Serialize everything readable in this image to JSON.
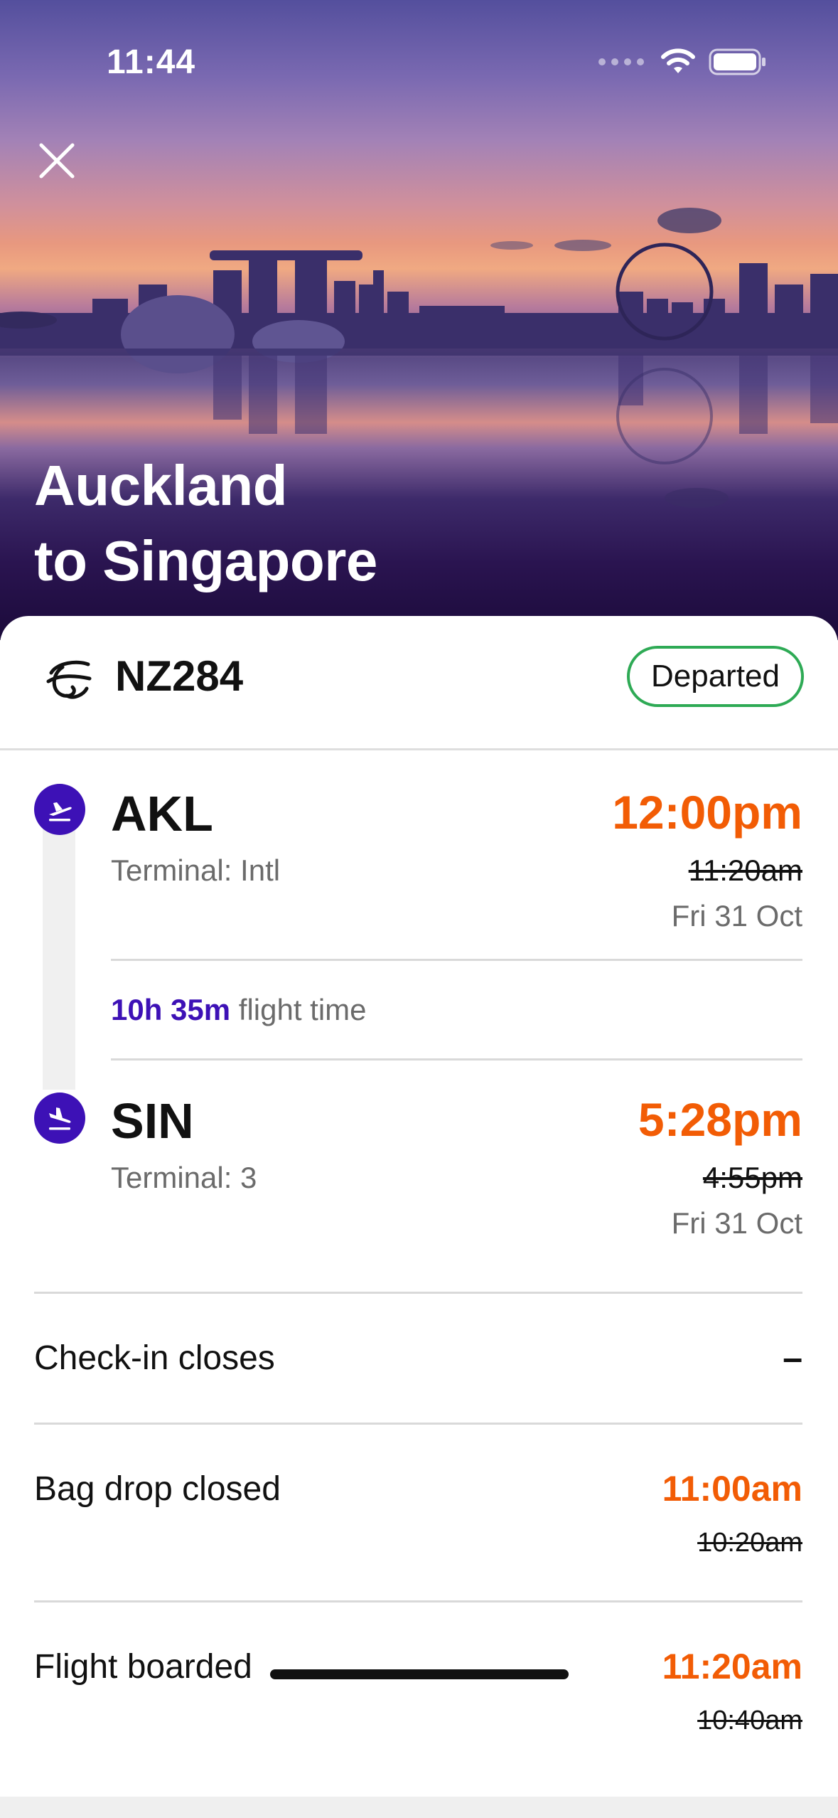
{
  "status_bar": {
    "time": "11:44"
  },
  "hero": {
    "title_line1": "Auckland",
    "title_line2": "to Singapore"
  },
  "flight": {
    "number": "NZ284",
    "status": "Departed"
  },
  "departure": {
    "code": "AKL",
    "terminal": "Terminal: Intl",
    "time_new": "12:00pm",
    "time_old": "11:20am",
    "date": "Fri 31 Oct"
  },
  "duration": {
    "value": "10h 35m",
    "label": "flight time"
  },
  "arrival": {
    "code": "SIN",
    "terminal": "Terminal: 3",
    "time_new": "5:28pm",
    "time_old": "4:55pm",
    "date": "Fri 31 Oct"
  },
  "milestones": [
    {
      "label": "Check-in closes",
      "value": "–"
    },
    {
      "label": "Bag drop closed",
      "time_new": "11:00am",
      "time_old": "10:20am"
    },
    {
      "label": "Flight boarded",
      "time_new": "11:20am",
      "time_old": "10:40am"
    }
  ],
  "colors": {
    "accent": "#3d11b6",
    "delay": "#f25c05",
    "badge_border": "#2eaa55"
  },
  "icons": [
    "close-icon",
    "airline-koru-icon",
    "takeoff-icon",
    "landing-icon",
    "wifi-icon",
    "battery-icon"
  ]
}
